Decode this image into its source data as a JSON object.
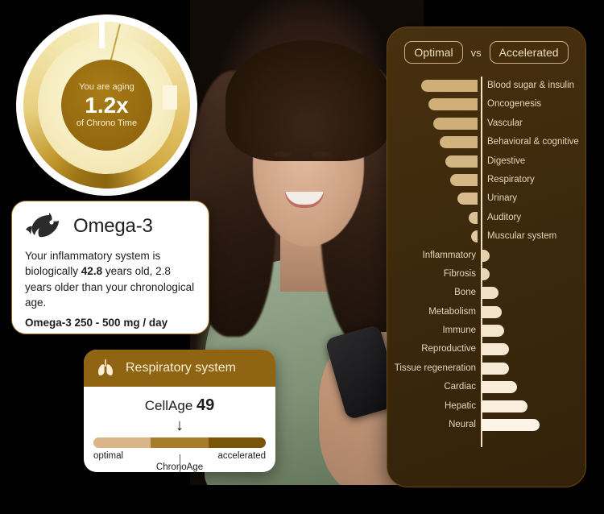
{
  "gauge": {
    "top_label": "You are aging",
    "value": "1.2x",
    "sub_label": "of Chrono Time",
    "ring_colors": [
      "#8a6410",
      "#f3e6ad",
      "#cda43a"
    ]
  },
  "omega_card": {
    "icon": "fish-icon",
    "title": "Omega-3",
    "body_pre": "Your inflammatory system is biologically ",
    "body_age": "42.8",
    "body_post": " years old, 2.8 years older than your chronological age.",
    "dose": "Omega-3  250 - 500 mg / day",
    "border_color": "#9a6c18"
  },
  "respiratory_card": {
    "icon": "lungs-icon",
    "header_title": "Respiratory system",
    "cellage_label": "CellAge",
    "cellage_value": "49",
    "arrow": "↓",
    "scale_left": "optimal",
    "scale_right": "accelerated",
    "chrono_label": "ChronoAge",
    "header_bg": "#8f6413",
    "bar_colors": [
      "#d9b589",
      "#a97c2c",
      "#7a5408"
    ]
  },
  "panel": {
    "toggle_optimal": "Optimal",
    "toggle_vs": "vs",
    "toggle_accelerated": "Accelerated",
    "bg_color": "#3d290c",
    "axis_color": "#f2e3c3"
  },
  "chart_data": {
    "type": "bar",
    "orientation": "horizontal-diverging",
    "title": "Optimal vs Accelerated",
    "xlabel": "",
    "ylabel": "",
    "legend": [
      "Optimal",
      "Accelerated"
    ],
    "axis_center": 0,
    "xlim": [
      -70,
      70
    ],
    "grid": false,
    "categories": [
      "Blood sugar & insulin",
      "Oncogenesis",
      "Vascular",
      "Behavioral & cognitive",
      "Digestive",
      "Respiratory",
      "Urinary",
      "Auditory",
      "Muscular system",
      "Inflammatory",
      "Fibrosis",
      "Bone",
      "Metabolism",
      "Immune",
      "Reproductive",
      "Tissue regeneration",
      "Cardiac",
      "Hepatic",
      "Neural"
    ],
    "values": [
      -66,
      -58,
      -52,
      -44,
      -38,
      -32,
      -24,
      -10,
      -8,
      9,
      9,
      20,
      24,
      26,
      32,
      32,
      42,
      54,
      68
    ],
    "bar_colors": [
      "#cfae78",
      "#d0af79",
      "#cfae77",
      "#d2b27f",
      "#d4b584",
      "#d6b888",
      "#d8bc8e",
      "#dcc298",
      "#e0c8a2",
      "#e6d0ae",
      "#ead7b8",
      "#f1e0c4",
      "#f3e3c9",
      "#f4e5cd",
      "#f6e8d2",
      "#f7ead6",
      "#f9edda",
      "#fbf0e0",
      "#fdf4e8"
    ]
  }
}
